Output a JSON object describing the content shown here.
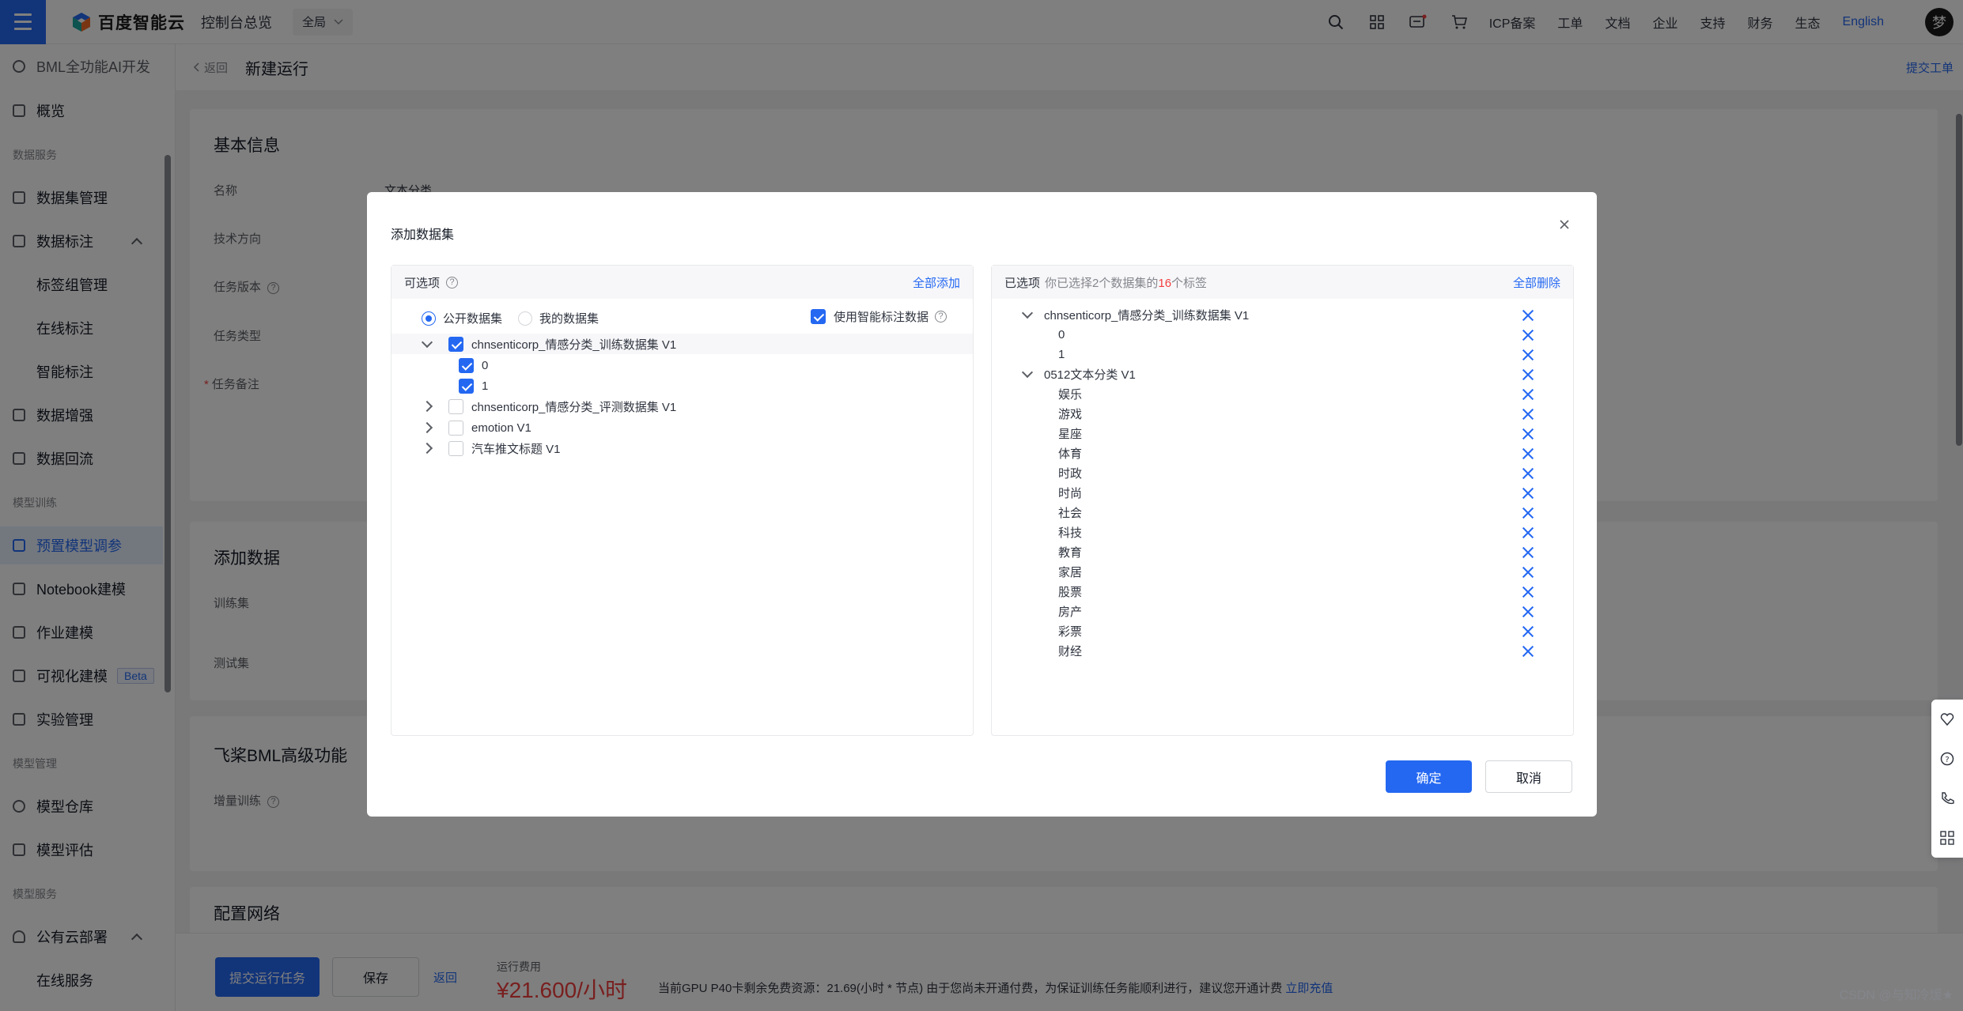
{
  "topbar": {
    "brand": "百度智能云",
    "console": "控制台总览",
    "scope": "全局",
    "links": [
      "ICP备案",
      "工单",
      "文档",
      "企业",
      "支持",
      "财务",
      "生态"
    ],
    "language": "English",
    "avatar": "梦"
  },
  "sidebar": {
    "app": "BML全功能AI开发",
    "overview": "概览",
    "group_data": "数据服务",
    "dataset_mgmt": "数据集管理",
    "data_label": "数据标注",
    "label_group": "标签组管理",
    "online_label": "在线标注",
    "smart_label": "智能标注",
    "data_augment": "数据增强",
    "data_reflow": "数据回流",
    "group_train": "模型训练",
    "preset_tuning": "预置模型调参",
    "notebook": "Notebook建模",
    "job_model": "作业建模",
    "visual_model": "可视化建模",
    "beta": "Beta",
    "experiment": "实验管理",
    "group_mgmt": "模型管理",
    "repo": "模型仓库",
    "evaluate": "模型评估",
    "group_service": "模型服务",
    "public_deploy": "公有云部署",
    "online_service": "在线服务"
  },
  "header": {
    "back": "返回",
    "title": "新建运行",
    "submit_ticket": "提交工单"
  },
  "form": {
    "basic_title": "基本信息",
    "name_label": "名称",
    "name_value": "文本分类",
    "direction_label": "技术方向",
    "version_label": "任务版本",
    "type_label": "任务类型",
    "remark_label": "任务备注",
    "add_data_title": "添加数据",
    "train_label": "训练集",
    "test_label": "测试集",
    "advanced_title": "飞桨BML高级功能",
    "incremental_label": "增量训练",
    "network_title": "配置网络"
  },
  "bottom": {
    "submit": "提交运行任务",
    "save": "保存",
    "back": "返回",
    "cost_label": "运行费用",
    "cost_value": "¥21.600/小时",
    "gpu_note": "当前GPU P40卡剩余免费资源：21.69(小时 * 节点) 由于您尚未开通付费，为保证训练任务能顺利进行，建议您开通计费",
    "recharge": "立即充值",
    "watermark": "CSDN @与知冷煖★"
  },
  "modal": {
    "title": "添加数据集",
    "left": {
      "header": "可选项",
      "add_all": "全部添加",
      "radio_public": "公开数据集",
      "radio_mine": "我的数据集",
      "smart_label": "使用智能标注数据",
      "tree": [
        {
          "label": "chnsenticorp_情感分类_训练数据集 V1",
          "expanded": true,
          "checked": true,
          "children": [
            {
              "label": "0",
              "checked": true
            },
            {
              "label": "1",
              "checked": true
            }
          ]
        },
        {
          "label": "chnsenticorp_情感分类_评测数据集 V1",
          "expanded": false,
          "checked": false
        },
        {
          "label": "emotion V1",
          "expanded": false,
          "checked": false
        },
        {
          "label": "汽车推文标题 V1",
          "expanded": false,
          "checked": false
        }
      ]
    },
    "right": {
      "header": "已选项",
      "summary_prefix": "你已选择2个数据集的",
      "summary_count": "16",
      "summary_suffix": "个标签",
      "delete_all": "全部删除",
      "groups": [
        {
          "label": "chnsenticorp_情感分类_训练数据集 V1",
          "children": [
            "0",
            "1"
          ]
        },
        {
          "label": "0512文本分类 V1",
          "children": [
            "娱乐",
            "游戏",
            "星座",
            "体育",
            "时政",
            "时尚",
            "社会",
            "科技",
            "教育",
            "家居",
            "股票",
            "房产",
            "彩票",
            "财经"
          ]
        }
      ]
    },
    "confirm": "确定",
    "cancel": "取消"
  },
  "colors": {
    "primary": "#2468f2",
    "danger": "#f33e3e",
    "mask": "rgba(0,0,0,0.5)"
  }
}
